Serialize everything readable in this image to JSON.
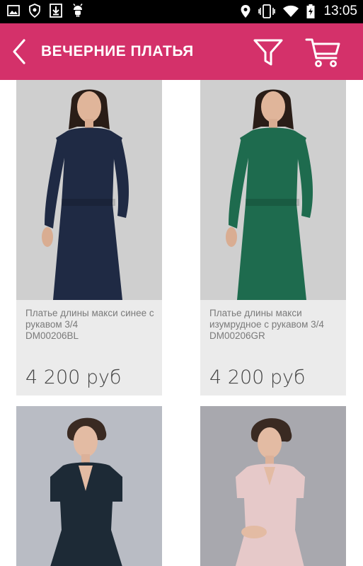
{
  "status_bar": {
    "time": "13:05",
    "left_icons": [
      "image-icon",
      "shield-icon",
      "download-icon",
      "android-icon"
    ],
    "right_icons": [
      "location-icon",
      "vibrate-icon",
      "wifi-icon",
      "battery-charging-icon"
    ]
  },
  "header": {
    "title": "ВЕЧЕРНИЕ ПЛАТЬЯ",
    "background_color": "#d4316a",
    "back_icon": "back-chevron-icon",
    "filter_icon": "filter-icon",
    "cart_icon": "cart-icon"
  },
  "products": [
    {
      "name": "Платье длины макси синее с рукавом 3/4",
      "sku": "DM00206BL",
      "price": "4 200 руб",
      "dress_color": "#1f2a44",
      "photo_bg": "#cfcfcf"
    },
    {
      "name": "Платье длины макси изумрудное с рукавом 3/4",
      "sku": "DM00206GR",
      "price": "4 200 руб",
      "dress_color": "#1e6b4e",
      "photo_bg": "#cfcfcf"
    },
    {
      "name": "",
      "sku": "",
      "price": "",
      "dress_color": "#1d2a36",
      "photo_bg": "#b9bcc4"
    },
    {
      "name": "",
      "sku": "",
      "price": "",
      "dress_color": "#e6c9c9",
      "photo_bg": "#a8a8ae"
    }
  ]
}
